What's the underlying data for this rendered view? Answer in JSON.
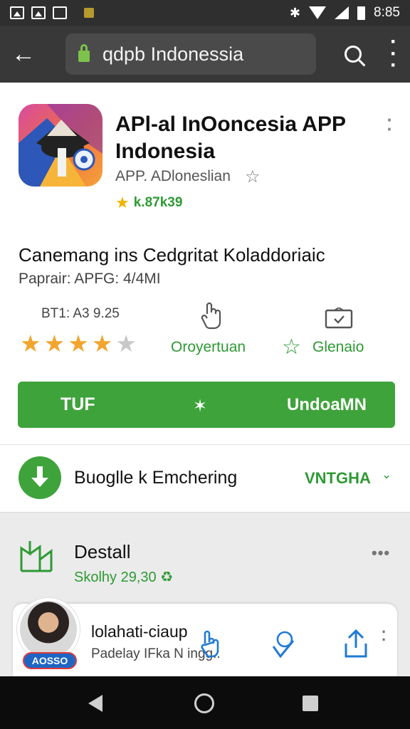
{
  "status_bar": {
    "time": "8:85",
    "bluetooth": "✱"
  },
  "app_bar": {
    "back": "←",
    "url": "qdpb Indonessia",
    "menu": "⋮"
  },
  "app": {
    "title": "APl-al InOoncesia APP Indonesia",
    "developer": "APP. ADloneslian",
    "rating_star": "★",
    "rating_value": "k.87k39",
    "description": "Canemang ins Cedgritat Koladdoriaic",
    "meta": "Paprair: APFG: 4/4MI",
    "stats_label": "BT1: A3 9.25",
    "stars_filled": 4,
    "stars_total": 5,
    "action1_label": "Oroyertuan",
    "action2_label": "Glenaio",
    "install_left": "TUF",
    "install_center": "✶",
    "install_right": "UndoaMN"
  },
  "download": {
    "text": "Buoglle k Emchering",
    "right": "VNTGHA",
    "chevron": "⌄"
  },
  "details": {
    "title": "Destall",
    "subtitle": "Skolhy 29,30 ♻",
    "more": "•••"
  },
  "share_card": {
    "title": "lolahati-ciaup",
    "subtitle": "Padelay IFka   N    ingg..",
    "badge": "AOSSO",
    "more": "⋮"
  },
  "colors": {
    "accent_green": "#3ea33b",
    "app_bar": "#383838",
    "status_bar": "#2f2f2f",
    "nav_bar": "#0c0c0c"
  }
}
